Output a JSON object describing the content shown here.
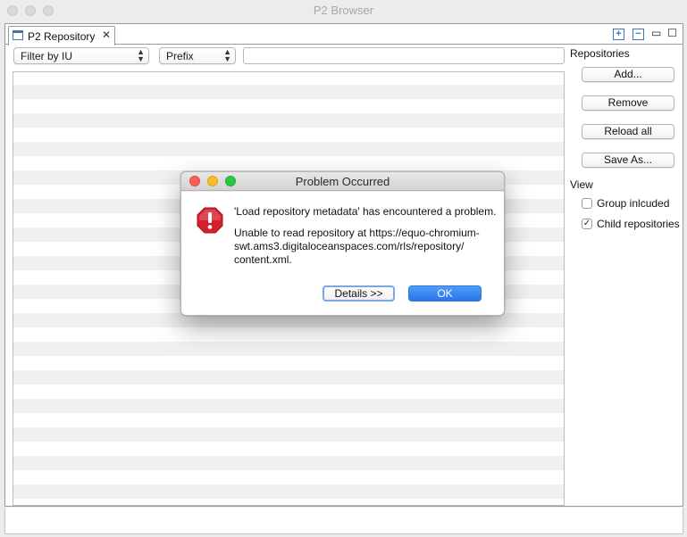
{
  "window": {
    "title": "P2 Browser"
  },
  "tab": {
    "label": "P2 Repository",
    "close": "✕"
  },
  "toolbar": {
    "expand_icon": "+",
    "collapse_icon": "−",
    "minimize": "▭",
    "maximize": "☐"
  },
  "filters": {
    "filter_by": "Filter by IU",
    "match_mode": "Prefix",
    "search_value": ""
  },
  "sidebar": {
    "repositories_heading": "Repositories",
    "buttons": [
      "Add...",
      "Remove",
      "Reload all",
      "Save As..."
    ],
    "view_heading": "View",
    "options": [
      {
        "label": "Group inlcuded",
        "checked": ""
      },
      {
        "label": "Child repositories",
        "checked": "✓"
      }
    ]
  },
  "dialog": {
    "title": "Problem Occurred",
    "message": "'Load repository metadata' has encountered a problem.",
    "detail_lines": [
      "Unable to read repository at https://equo-chromium-",
      "swt.ams3.digitaloceanspaces.com/rls/repository/",
      "content.xml."
    ],
    "details_button": "Details >>",
    "ok_button": "OK",
    "icon": "error-icon",
    "colors": {
      "close": "#fc5f57",
      "minimize": "#fdbc2e",
      "zoom": "#28c840",
      "ok": "#2f7ff0",
      "error": "#d4202a"
    }
  }
}
